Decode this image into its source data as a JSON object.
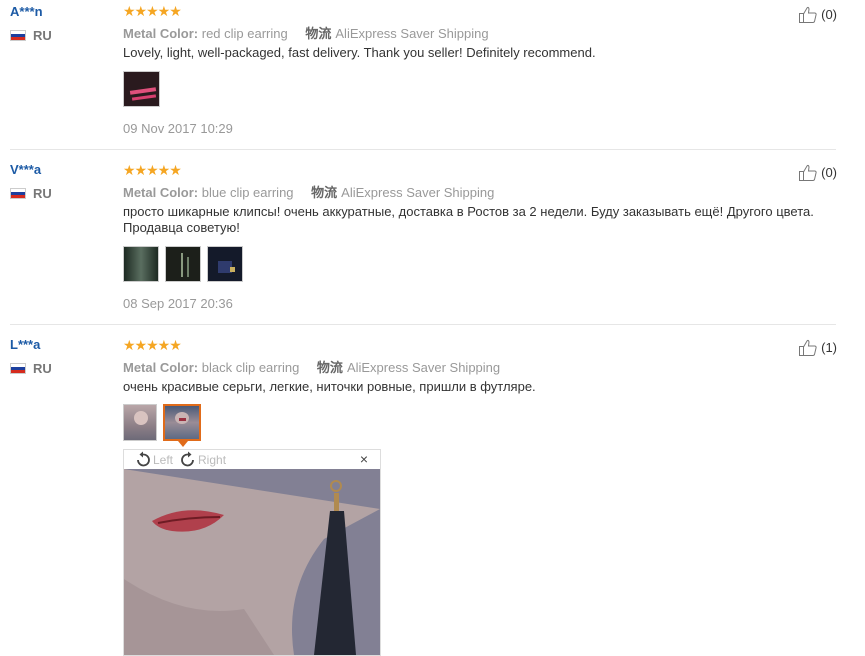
{
  "reviews": [
    {
      "user": "A***n",
      "country": "RU",
      "stars": "★★★★★",
      "attr_key": "Metal Color:",
      "attr_val": "red clip earring",
      "ship_key": "物流",
      "ship_val": "AliExpress Saver Shipping",
      "text": "Lovely, light, well-packaged, fast delivery. Thank you seller! Definitely recommend.",
      "date": "09 Nov 2017 10:29",
      "likes": "(0)"
    },
    {
      "user": "V***a",
      "country": "RU",
      "stars": "★★★★★",
      "attr_key": "Metal Color:",
      "attr_val": "blue clip earring",
      "ship_key": "物流",
      "ship_val": "AliExpress Saver Shipping",
      "text": "просто шикарные клипсы! очень аккуратные, доставка в Ростов за 2 недели. Буду заказывать ещё! Другого цвета. Продавца советую!",
      "date": "08 Sep 2017 20:36",
      "likes": "(0)"
    },
    {
      "user": "L***a",
      "country": "RU",
      "stars": "★★★★★",
      "attr_key": "Metal Color:",
      "attr_val": "black clip earring",
      "ship_key": "物流",
      "ship_val": "AliExpress Saver Shipping",
      "text": "очень красивые серьги, легкие, ниточки ровные, пришли в футляре.",
      "likes": "(1)"
    }
  ],
  "viewer": {
    "left_label": "Left",
    "right_label": "Right",
    "close": "×"
  }
}
